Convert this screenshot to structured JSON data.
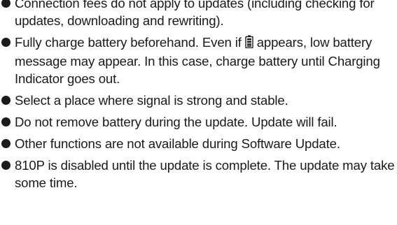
{
  "notes": [
    {
      "text": "Connection fees do not apply to updates (including checking for updates, downloading and rewriting)."
    },
    {
      "text_before_icon": "Fully charge battery beforehand. Even if",
      "icon": "battery-full-icon",
      "text_after_icon": "appears, low battery message may appear. In this case, charge battery until Charging Indicator goes out."
    },
    {
      "text": "Select a place where signal is strong and stable."
    },
    {
      "text": "Do not remove battery during the update. Update will fail."
    },
    {
      "text": "Other functions are not available during Software Update."
    },
    {
      "text": "810P is disabled until the update is complete. The update may take some time."
    }
  ]
}
